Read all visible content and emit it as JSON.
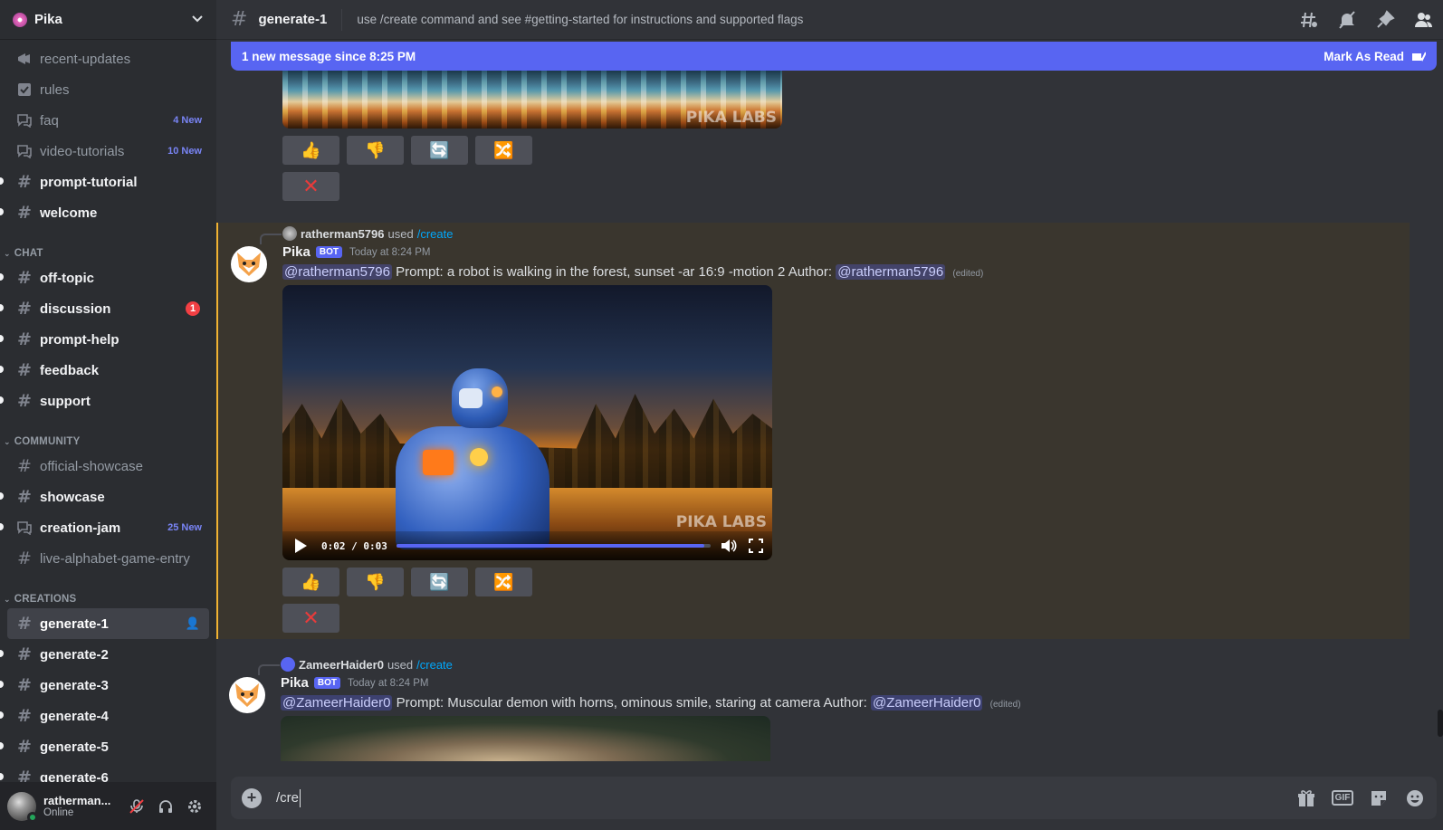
{
  "server": {
    "name": "Pika"
  },
  "sidebar": {
    "top_channels": [
      {
        "name": "recent-updates",
        "icon": "megaphone-icon",
        "badge": ""
      },
      {
        "name": "rules",
        "icon": "checkbox-icon",
        "badge": ""
      },
      {
        "name": "faq",
        "icon": "forum-icon",
        "badge": "4 New"
      },
      {
        "name": "video-tutorials",
        "icon": "forum-icon",
        "badge": "10 New"
      },
      {
        "name": "prompt-tutorial",
        "icon": "hash-icon",
        "badge": ""
      },
      {
        "name": "welcome",
        "icon": "hash-icon",
        "badge": ""
      }
    ],
    "categories": [
      {
        "name": "CHAT",
        "channels": [
          {
            "name": "off-topic",
            "badge": ""
          },
          {
            "name": "discussion",
            "badge": "1"
          },
          {
            "name": "prompt-help",
            "badge": ""
          },
          {
            "name": "feedback",
            "badge": ""
          },
          {
            "name": "support",
            "badge": ""
          }
        ]
      },
      {
        "name": "COMMUNITY",
        "channels": [
          {
            "name": "official-showcase",
            "badge": ""
          },
          {
            "name": "showcase",
            "badge": ""
          },
          {
            "name": "creation-jam",
            "badge": "25 New"
          },
          {
            "name": "live-alphabet-game-entry",
            "badge": ""
          }
        ]
      },
      {
        "name": "CREATIONS",
        "channels": [
          {
            "name": "generate-1",
            "badge": ""
          },
          {
            "name": "generate-2",
            "badge": ""
          },
          {
            "name": "generate-3",
            "badge": ""
          },
          {
            "name": "generate-4",
            "badge": ""
          },
          {
            "name": "generate-5",
            "badge": ""
          },
          {
            "name": "generate-6",
            "badge": ""
          }
        ]
      }
    ],
    "user": {
      "name": "ratherman...",
      "status": "Online"
    }
  },
  "topbar": {
    "channel": "generate-1",
    "topic": "use /create command and see #getting-started for instructions and supported flags"
  },
  "banner": {
    "text": "1 new message since 8:25 PM",
    "action": "Mark As Read"
  },
  "messages": [
    {
      "used_by": "ratherman5796",
      "used_word": "used",
      "command": "/create",
      "author": "Pika",
      "tag": "BOT",
      "timestamp": "Today at 8:24 PM",
      "mention": "@ratherman5796",
      "prompt": "Prompt: a robot is walking in the forest, sunset -ar 16:9 -motion 2",
      "author_label": "Author:",
      "author_mention": "@ratherman5796",
      "edited": "(edited)",
      "video": {
        "time": "0:02 / 0:03",
        "progress": 0.98
      }
    },
    {
      "used_by": "ZameerHaider0",
      "used_word": "used",
      "command": "/create",
      "author": "Pika",
      "tag": "BOT",
      "timestamp": "Today at 8:24 PM",
      "mention": "@ZameerHaider0",
      "prompt": "Prompt: Muscular demon with horns, ominous smile, staring at camera",
      "author_label": "Author:",
      "author_mention": "@ZameerHaider0",
      "edited": "(edited)"
    }
  ],
  "watermark": "PIKA LABS",
  "composer": {
    "value": "/cre"
  },
  "colors": {
    "accent": "#5865f2",
    "highlight_border": "#f0b232",
    "danger": "#f23f43"
  }
}
